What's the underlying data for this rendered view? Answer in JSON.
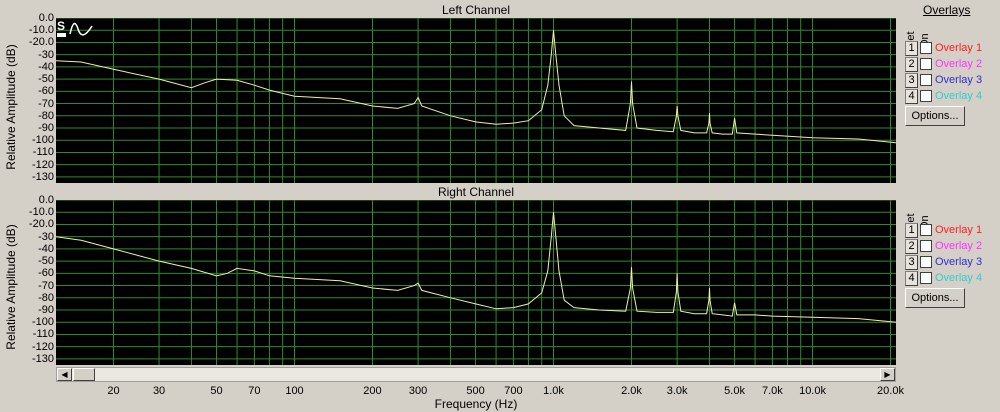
{
  "colors": {
    "grid": "#2f8a2f",
    "trace": "#f0f0a0",
    "overlay1": "#ff2020",
    "overlay2": "#ff33ff",
    "overlay3": "#3030c8",
    "overlay4": "#33cccc"
  },
  "side_panel": {
    "overlays_title": "Overlays",
    "set_header": "Set",
    "on_header": "On",
    "options_label": "Options..."
  },
  "overlays": [
    {
      "num": "1",
      "label": "Overlay 1",
      "color": "#ff2020"
    },
    {
      "num": "2",
      "label": "Overlay 2",
      "color": "#ff33ff"
    },
    {
      "num": "3",
      "label": "Overlay 3",
      "color": "#3030c8"
    },
    {
      "num": "4",
      "label": "Overlay 4",
      "color": "#33cccc"
    }
  ],
  "icons": [
    "spectrum-logo-icon",
    "scroll-left-icon",
    "scroll-right-icon"
  ],
  "chart_data": [
    {
      "type": "line",
      "title": "Left Channel",
      "xlabel": "Frequency (Hz)",
      "ylabel": "Relative Amplitude (dB)",
      "xscale": "log",
      "xlim": [
        12,
        21000
      ],
      "ylim": [
        -135,
        0
      ],
      "x_ticks": [
        "20",
        "30",
        "50",
        "70",
        "100",
        "200",
        "300",
        "500",
        "700",
        "1.0k",
        "2.0k",
        "3.0k",
        "5.0k",
        "7.0k",
        "10.0k",
        "20.0k"
      ],
      "y_ticks": [
        "0.0",
        "-10.0",
        "-20.0",
        "-30",
        "-40",
        "-50",
        "-60",
        "-70",
        "-80",
        "-90",
        "-100",
        "-110",
        "-120",
        "-130"
      ],
      "grid": true,
      "series": [
        {
          "x": [
            12,
            15,
            20,
            30,
            40,
            45,
            50,
            60,
            70,
            80,
            100,
            150,
            200,
            250,
            290,
            300,
            310,
            400,
            500,
            600,
            700,
            800,
            900,
            950,
            980,
            1000,
            1020,
            1050,
            1100,
            1200,
            1500,
            1900,
            1980,
            2000,
            2020,
            2100,
            2500,
            2900,
            2980,
            3000,
            3020,
            3100,
            3500,
            3900,
            3980,
            4000,
            4020,
            4100,
            4500,
            4900,
            5000,
            5100,
            6000,
            7000,
            10000,
            15000,
            21000
          ],
          "y": [
            -35,
            -36,
            -42,
            -50,
            -57,
            -53,
            -50,
            -51,
            -55,
            -59,
            -64,
            -66,
            -72,
            -74,
            -70,
            -65,
            -72,
            -80,
            -85,
            -87,
            -86,
            -84,
            -75,
            -55,
            -30,
            -10,
            -30,
            -55,
            -80,
            -88,
            -90,
            -92,
            -70,
            -52,
            -70,
            -90,
            -92,
            -93,
            -80,
            -72,
            -80,
            -92,
            -94,
            -94,
            -86,
            -78,
            -86,
            -94,
            -95,
            -95,
            -82,
            -94,
            -95,
            -96,
            -98,
            -99,
            -102
          ]
        }
      ]
    },
    {
      "type": "line",
      "title": "Right Channel",
      "xlabel": "Frequency (Hz)",
      "ylabel": "Relative Amplitude (dB)",
      "xscale": "log",
      "xlim": [
        12,
        21000
      ],
      "ylim": [
        -135,
        0
      ],
      "x_ticks": [
        "20",
        "30",
        "50",
        "70",
        "100",
        "200",
        "300",
        "500",
        "700",
        "1.0k",
        "2.0k",
        "3.0k",
        "5.0k",
        "7.0k",
        "10.0k",
        "20.0k"
      ],
      "y_ticks": [
        "0.0",
        "-10.0",
        "-20.0",
        "-30",
        "-40",
        "-50",
        "-60",
        "-70",
        "-80",
        "-90",
        "-100",
        "-110",
        "-120",
        "-130"
      ],
      "grid": true,
      "series": [
        {
          "x": [
            12,
            15,
            20,
            30,
            40,
            50,
            55,
            60,
            70,
            80,
            100,
            150,
            200,
            250,
            290,
            300,
            310,
            400,
            500,
            600,
            700,
            800,
            900,
            950,
            980,
            1000,
            1020,
            1050,
            1100,
            1200,
            1500,
            1900,
            1980,
            2000,
            2020,
            2100,
            2500,
            2900,
            2980,
            3000,
            3020,
            3100,
            3500,
            3900,
            3980,
            4000,
            4020,
            4100,
            4500,
            4900,
            5000,
            5100,
            6000,
            7000,
            10000,
            15000,
            21000
          ],
          "y": [
            -30,
            -33,
            -40,
            -50,
            -56,
            -62,
            -60,
            -56,
            -58,
            -62,
            -64,
            -66,
            -72,
            -74,
            -70,
            -68,
            -74,
            -80,
            -85,
            -89,
            -88,
            -85,
            -76,
            -58,
            -30,
            -10,
            -30,
            -58,
            -82,
            -88,
            -90,
            -91,
            -72,
            -55,
            -72,
            -91,
            -92,
            -92,
            -75,
            -60,
            -75,
            -91,
            -93,
            -93,
            -82,
            -72,
            -82,
            -93,
            -94,
            -95,
            -84,
            -94,
            -94,
            -95,
            -96,
            -97,
            -100
          ]
        }
      ]
    }
  ]
}
